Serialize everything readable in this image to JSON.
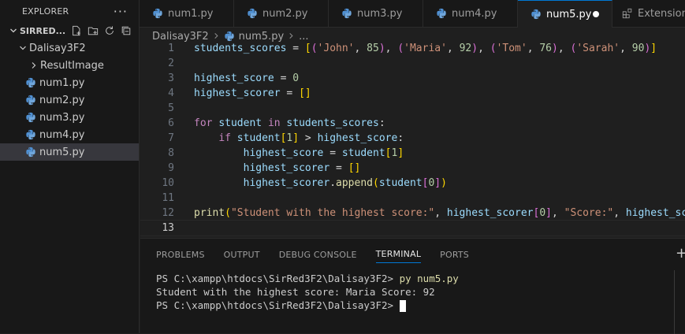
{
  "explorer": {
    "title": "EXPLORER",
    "more": "···",
    "root": "SIRRED...",
    "folder": "Dalisay3F2",
    "subfolder": "ResultImage",
    "files": [
      "num1.py",
      "num2.py",
      "num3.py",
      "num4.py",
      "num5.py"
    ]
  },
  "tabs": [
    "num1.py",
    "num2.py",
    "num3.py",
    "num4.py",
    "num5.py",
    "Extension:"
  ],
  "breadcrumb": {
    "folder": "Dalisay3F2",
    "file": "num5.py",
    "rest": "..."
  },
  "editor": {
    "line_numbers": [
      "1",
      "2",
      "3",
      "4",
      "5",
      "6",
      "7",
      "8",
      "9",
      "10",
      "11",
      "12",
      "13"
    ],
    "lines": [
      [
        {
          "t": "students_scores",
          "c": "vr"
        },
        {
          "t": " = ",
          "c": "op"
        },
        {
          "t": "[",
          "c": "br1"
        },
        {
          "t": "(",
          "c": "br2"
        },
        {
          "t": "'John'",
          "c": "st"
        },
        {
          "t": ", ",
          "c": "op"
        },
        {
          "t": "85",
          "c": "nm"
        },
        {
          "t": ")",
          "c": "br2"
        },
        {
          "t": ", ",
          "c": "op"
        },
        {
          "t": "(",
          "c": "br2"
        },
        {
          "t": "'Maria'",
          "c": "st"
        },
        {
          "t": ", ",
          "c": "op"
        },
        {
          "t": "92",
          "c": "nm"
        },
        {
          "t": ")",
          "c": "br2"
        },
        {
          "t": ", ",
          "c": "op"
        },
        {
          "t": "(",
          "c": "br2"
        },
        {
          "t": "'Tom'",
          "c": "st"
        },
        {
          "t": ", ",
          "c": "op"
        },
        {
          "t": "76",
          "c": "nm"
        },
        {
          "t": ")",
          "c": "br2"
        },
        {
          "t": ", ",
          "c": "op"
        },
        {
          "t": "(",
          "c": "br2"
        },
        {
          "t": "'Sarah'",
          "c": "st"
        },
        {
          "t": ", ",
          "c": "op"
        },
        {
          "t": "90",
          "c": "nm"
        },
        {
          "t": ")",
          "c": "br2"
        },
        {
          "t": "]",
          "c": "br1"
        }
      ],
      [],
      [
        {
          "t": "highest_score",
          "c": "vr"
        },
        {
          "t": " = ",
          "c": "op"
        },
        {
          "t": "0",
          "c": "nm"
        }
      ],
      [
        {
          "t": "highest_scorer",
          "c": "vr"
        },
        {
          "t": " = ",
          "c": "op"
        },
        {
          "t": "[]",
          "c": "br1"
        }
      ],
      [],
      [
        {
          "t": "for",
          "c": "kw"
        },
        {
          "t": " ",
          "c": "op"
        },
        {
          "t": "student",
          "c": "vr"
        },
        {
          "t": " ",
          "c": "op"
        },
        {
          "t": "in",
          "c": "kw"
        },
        {
          "t": " ",
          "c": "op"
        },
        {
          "t": "students_scores",
          "c": "vr"
        },
        {
          "t": ":",
          "c": "op"
        }
      ],
      [
        {
          "t": "    ",
          "c": "op"
        },
        {
          "t": "if",
          "c": "kw"
        },
        {
          "t": " ",
          "c": "op"
        },
        {
          "t": "student",
          "c": "vr"
        },
        {
          "t": "[",
          "c": "br1"
        },
        {
          "t": "1",
          "c": "nm"
        },
        {
          "t": "]",
          "c": "br1"
        },
        {
          "t": " > ",
          "c": "op"
        },
        {
          "t": "highest_score",
          "c": "vr"
        },
        {
          "t": ":",
          "c": "op"
        }
      ],
      [
        {
          "t": "        ",
          "c": "op"
        },
        {
          "t": "highest_score",
          "c": "vr"
        },
        {
          "t": " = ",
          "c": "op"
        },
        {
          "t": "student",
          "c": "vr"
        },
        {
          "t": "[",
          "c": "br1"
        },
        {
          "t": "1",
          "c": "nm"
        },
        {
          "t": "]",
          "c": "br1"
        }
      ],
      [
        {
          "t": "        ",
          "c": "op"
        },
        {
          "t": "highest_scorer",
          "c": "vr"
        },
        {
          "t": " = ",
          "c": "op"
        },
        {
          "t": "[]",
          "c": "br1"
        }
      ],
      [
        {
          "t": "        ",
          "c": "op"
        },
        {
          "t": "highest_scorer",
          "c": "vr"
        },
        {
          "t": ".",
          "c": "op"
        },
        {
          "t": "append",
          "c": "fn"
        },
        {
          "t": "(",
          "c": "br1"
        },
        {
          "t": "student",
          "c": "vr"
        },
        {
          "t": "[",
          "c": "br2"
        },
        {
          "t": "0",
          "c": "nm"
        },
        {
          "t": "]",
          "c": "br2"
        },
        {
          "t": ")",
          "c": "br1"
        }
      ],
      [],
      [
        {
          "t": "print",
          "c": "fn"
        },
        {
          "t": "(",
          "c": "br1"
        },
        {
          "t": "\"Student with the highest score:\"",
          "c": "st"
        },
        {
          "t": ", ",
          "c": "op"
        },
        {
          "t": "highest_scorer",
          "c": "vr"
        },
        {
          "t": "[",
          "c": "br2"
        },
        {
          "t": "0",
          "c": "nm"
        },
        {
          "t": "]",
          "c": "br2"
        },
        {
          "t": ", ",
          "c": "op"
        },
        {
          "t": "\"Score:\"",
          "c": "st"
        },
        {
          "t": ", ",
          "c": "op"
        },
        {
          "t": "highest_sco",
          "c": "vr"
        }
      ],
      []
    ]
  },
  "panel": {
    "tabs": [
      "PROBLEMS",
      "OUTPUT",
      "DEBUG CONSOLE",
      "TERMINAL",
      "PORTS"
    ],
    "plus": "+",
    "terminal": {
      "prompt": "PS C:\\xampp\\htdocs\\SirRed3F2\\Dalisay3F2> ",
      "command": "py num5.py",
      "output": "Student with the highest score: Maria Score: 92",
      "prompt2": "PS C:\\xampp\\htdocs\\SirRed3F2\\Dalisay3F2> "
    }
  }
}
